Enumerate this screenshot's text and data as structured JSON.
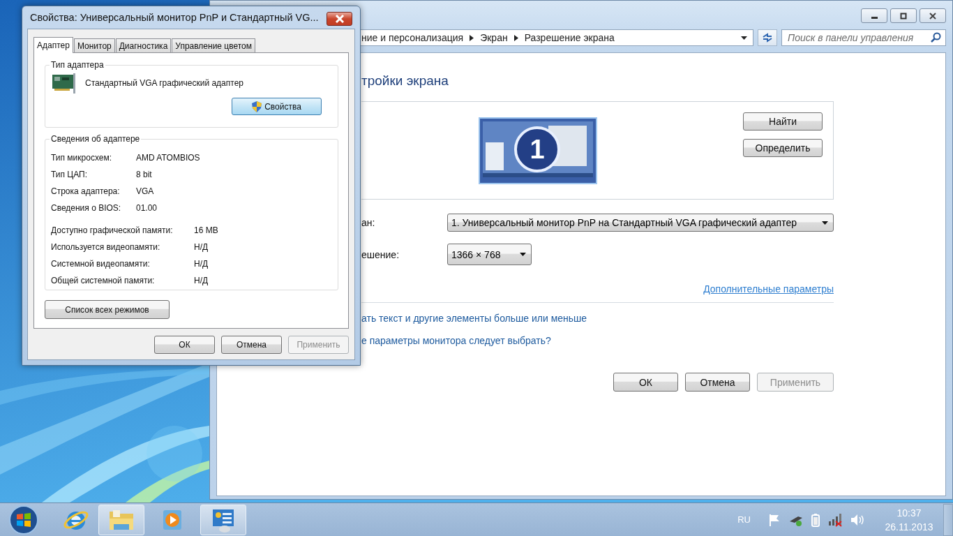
{
  "control_panel": {
    "breadcrumb": [
      "ние и персонализация",
      "Экран",
      "Разрешение экрана"
    ],
    "search": {
      "placeholder": "Поиск в панели управления"
    },
    "heading": "тройки экрана",
    "monitor_number": "1",
    "side_buttons": [
      "Найти",
      "Определить"
    ],
    "fields": [
      {
        "label": "ан:",
        "value": "1. Универсальный монитор PnP на Стандартный VGA графический адаптер",
        "kind": "wide"
      },
      {
        "label": "ешение:",
        "value": "1366 × 768",
        "kind": "narrow"
      }
    ],
    "advanced_link": "Дополнительные параметры",
    "links": [
      "ать текст и другие элементы больше или меньше",
      "е параметры монитора следует выбрать?"
    ],
    "buttons": [
      {
        "label": "ОК",
        "disabled": false
      },
      {
        "label": "Отмена",
        "disabled": false
      },
      {
        "label": "Применить",
        "disabled": true
      }
    ]
  },
  "dialog": {
    "title": "Свойства: Универсальный монитор PnP и Стандартный VG...",
    "tabs": [
      {
        "label": "Адаптер",
        "selected": true
      },
      {
        "label": "Монитор",
        "selected": false
      },
      {
        "label": "Диагностика",
        "selected": false
      },
      {
        "label": "Управление цветом",
        "selected": false
      }
    ],
    "adapter_type": {
      "legend": "Тип адаптера",
      "name": "Стандартный VGA графический адаптер",
      "button": "Свойства"
    },
    "adapter_info": {
      "legend": "Сведения об адаптере",
      "sections": [
        {
          "rows": [
            {
              "label": "Тип микросхем:",
              "value": "AMD ATOMBIOS"
            },
            {
              "label": "Тип ЦАП:",
              "value": "8 bit"
            },
            {
              "label": "Строка адаптера:",
              "value": "VGA"
            },
            {
              "label": "Сведения о BIOS:",
              "value": "01.00"
            }
          ]
        },
        {
          "rows": [
            {
              "label": "Доступно графической памяти:",
              "value": "16 MB"
            },
            {
              "label": "Используется видеопамяти:",
              "value": "Н/Д"
            },
            {
              "label": "Системной видеопамяти:",
              "value": "Н/Д"
            },
            {
              "label": "Общей системной памяти:",
              "value": "Н/Д"
            }
          ]
        }
      ]
    },
    "list_button": "Список всех режимов",
    "buttons": [
      {
        "label": "ОК",
        "disabled": false
      },
      {
        "label": "Отмена",
        "disabled": false
      },
      {
        "label": "Применить",
        "disabled": true
      }
    ]
  },
  "taskbar": {
    "apps": [
      {
        "kind": "ie",
        "running": false
      },
      {
        "kind": "explorer",
        "running": true
      },
      {
        "kind": "media",
        "running": false
      },
      {
        "kind": "control",
        "running": true
      }
    ],
    "language": "RU",
    "time": "10:37",
    "date": "26.11.2013"
  }
}
